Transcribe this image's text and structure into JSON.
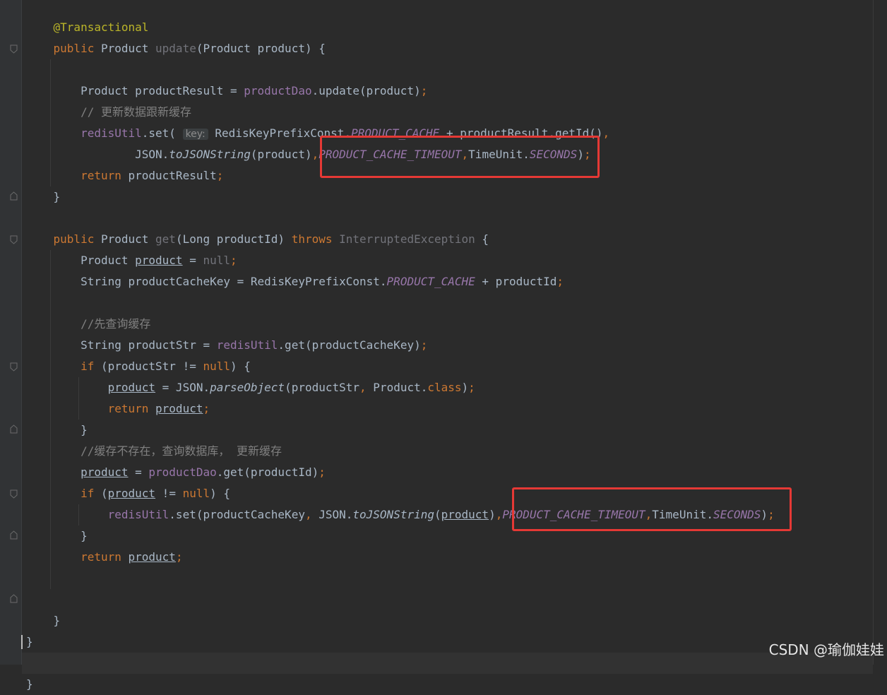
{
  "editor": {
    "lines": [
      {
        "segments": [
          {
            "t": "    "
          },
          {
            "t": "@Transactional",
            "c": "ann"
          }
        ]
      },
      {
        "segments": [
          {
            "t": "    "
          },
          {
            "t": "public ",
            "c": "kw"
          },
          {
            "t": "Product "
          },
          {
            "t": "update",
            "c": "unused"
          },
          {
            "t": "(Product product) {"
          }
        ]
      },
      {
        "segments": [
          {
            "t": ""
          }
        ]
      },
      {
        "segments": [
          {
            "t": "        Product productResult = "
          },
          {
            "t": "productDao",
            "c": "fld"
          },
          {
            "t": ".update(product)"
          },
          {
            "t": ";",
            "c": "kw"
          }
        ]
      },
      {
        "segments": [
          {
            "t": "        "
          },
          {
            "t": "// 更新数据跟新缓存",
            "c": "cmt"
          }
        ]
      },
      {
        "segments": [
          {
            "t": "        "
          },
          {
            "t": "redisUtil",
            "c": "fld"
          },
          {
            "t": ".set( "
          },
          {
            "t": "key:",
            "c": "hint"
          },
          {
            "t": " RedisKeyPrefixConst."
          },
          {
            "t": "PRODUCT_CACHE",
            "c": "sfld"
          },
          {
            "t": " + productResult.getId()"
          },
          {
            "t": ",",
            "c": "kw"
          }
        ]
      },
      {
        "segments": [
          {
            "t": "                JSON."
          },
          {
            "t": "toJSONString",
            "c": "smeth"
          },
          {
            "t": "(product)"
          },
          {
            "t": ",",
            "c": "kw"
          },
          {
            "t": "PRODUCT_CACHE_TIMEOUT",
            "c": "sfld"
          },
          {
            "t": ",",
            "c": "kw"
          },
          {
            "t": "TimeUnit."
          },
          {
            "t": "SECONDS",
            "c": "sfld"
          },
          {
            "t": ")"
          },
          {
            "t": ";",
            "c": "kw"
          }
        ]
      },
      {
        "segments": [
          {
            "t": "        "
          },
          {
            "t": "return ",
            "c": "kw"
          },
          {
            "t": "productResult"
          },
          {
            "t": ";",
            "c": "kw"
          }
        ]
      },
      {
        "segments": [
          {
            "t": "    }"
          }
        ]
      },
      {
        "segments": [
          {
            "t": ""
          }
        ]
      },
      {
        "segments": [
          {
            "t": "    "
          },
          {
            "t": "public ",
            "c": "kw"
          },
          {
            "t": "Product "
          },
          {
            "t": "get",
            "c": "unused"
          },
          {
            "t": "(Long productId) "
          },
          {
            "t": "throws ",
            "c": "kw"
          },
          {
            "t": "InterruptedException",
            "c": "unused"
          },
          {
            "t": " {"
          }
        ]
      },
      {
        "segments": [
          {
            "t": "        Product "
          },
          {
            "t": "product",
            "c": "var-u"
          },
          {
            "t": " = "
          },
          {
            "t": "null",
            "c": "unused"
          },
          {
            "t": ";",
            "c": "kw"
          }
        ]
      },
      {
        "segments": [
          {
            "t": "        String productCacheKey = RedisKeyPrefixConst."
          },
          {
            "t": "PRODUCT_CACHE",
            "c": "sfld"
          },
          {
            "t": " + productId"
          },
          {
            "t": ";",
            "c": "kw"
          }
        ]
      },
      {
        "segments": [
          {
            "t": ""
          }
        ]
      },
      {
        "segments": [
          {
            "t": "        "
          },
          {
            "t": "//先查询缓存",
            "c": "cmt"
          }
        ]
      },
      {
        "segments": [
          {
            "t": "        String productStr = "
          },
          {
            "t": "redisUtil",
            "c": "fld"
          },
          {
            "t": ".get(productCacheKey)"
          },
          {
            "t": ";",
            "c": "kw"
          }
        ]
      },
      {
        "segments": [
          {
            "t": "        "
          },
          {
            "t": "if ",
            "c": "kw"
          },
          {
            "t": "(productStr != "
          },
          {
            "t": "null",
            "c": "kw"
          },
          {
            "t": ") {"
          }
        ]
      },
      {
        "segments": [
          {
            "t": "            "
          },
          {
            "t": "product",
            "c": "var-u"
          },
          {
            "t": " = JSON."
          },
          {
            "t": "parseObject",
            "c": "smeth"
          },
          {
            "t": "(productStr"
          },
          {
            "t": ", ",
            "c": "kw"
          },
          {
            "t": "Product."
          },
          {
            "t": "class",
            "c": "kw"
          },
          {
            "t": ")"
          },
          {
            "t": ";",
            "c": "kw"
          }
        ]
      },
      {
        "segments": [
          {
            "t": "            "
          },
          {
            "t": "return ",
            "c": "kw"
          },
          {
            "t": "product",
            "c": "var-u"
          },
          {
            "t": ";",
            "c": "kw"
          }
        ]
      },
      {
        "segments": [
          {
            "t": "        }"
          }
        ]
      },
      {
        "segments": [
          {
            "t": "        "
          },
          {
            "t": "//缓存不存在，查询数据库， 更新缓存",
            "c": "cmt"
          }
        ]
      },
      {
        "segments": [
          {
            "t": "        "
          },
          {
            "t": "product",
            "c": "var-u"
          },
          {
            "t": " = "
          },
          {
            "t": "productDao",
            "c": "fld"
          },
          {
            "t": ".get(productId)"
          },
          {
            "t": ";",
            "c": "kw"
          }
        ]
      },
      {
        "segments": [
          {
            "t": "        "
          },
          {
            "t": "if ",
            "c": "kw"
          },
          {
            "t": "("
          },
          {
            "t": "product",
            "c": "var-u"
          },
          {
            "t": " != "
          },
          {
            "t": "null",
            "c": "kw"
          },
          {
            "t": ") {"
          }
        ]
      },
      {
        "segments": [
          {
            "t": "            "
          },
          {
            "t": "redisUtil",
            "c": "fld"
          },
          {
            "t": ".set(productCacheKey"
          },
          {
            "t": ", ",
            "c": "kw"
          },
          {
            "t": "JSON."
          },
          {
            "t": "toJSONString",
            "c": "smeth"
          },
          {
            "t": "("
          },
          {
            "t": "product",
            "c": "var-u"
          },
          {
            "t": ")"
          },
          {
            "t": ",",
            "c": "kw"
          },
          {
            "t": "PRODUCT_CACHE_TIMEOUT",
            "c": "sfld"
          },
          {
            "t": ",",
            "c": "kw"
          },
          {
            "t": "TimeUnit."
          },
          {
            "t": "SECONDS",
            "c": "sfld"
          },
          {
            "t": ")"
          },
          {
            "t": ";",
            "c": "kw"
          }
        ]
      },
      {
        "segments": [
          {
            "t": "        }"
          }
        ]
      },
      {
        "segments": [
          {
            "t": "        "
          },
          {
            "t": "return ",
            "c": "kw"
          },
          {
            "t": "product",
            "c": "var-u"
          },
          {
            "t": ";",
            "c": "kw"
          }
        ]
      },
      {
        "segments": [
          {
            "t": ""
          }
        ]
      },
      {
        "segments": [
          {
            "t": ""
          }
        ]
      },
      {
        "segments": [
          {
            "t": "    }"
          }
        ]
      },
      {
        "segments": [
          {
            "t": "}"
          }
        ]
      },
      {
        "segments": [
          {
            "t": ""
          }
        ],
        "current": true
      },
      {
        "segments": [
          {
            "t": "}"
          }
        ]
      }
    ]
  },
  "watermark": "CSDN @瑜伽娃娃",
  "colors": {
    "highlight": "#e53935",
    "keyword": "#cc7832",
    "field": "#9876aa",
    "annotation": "#bbb529"
  }
}
